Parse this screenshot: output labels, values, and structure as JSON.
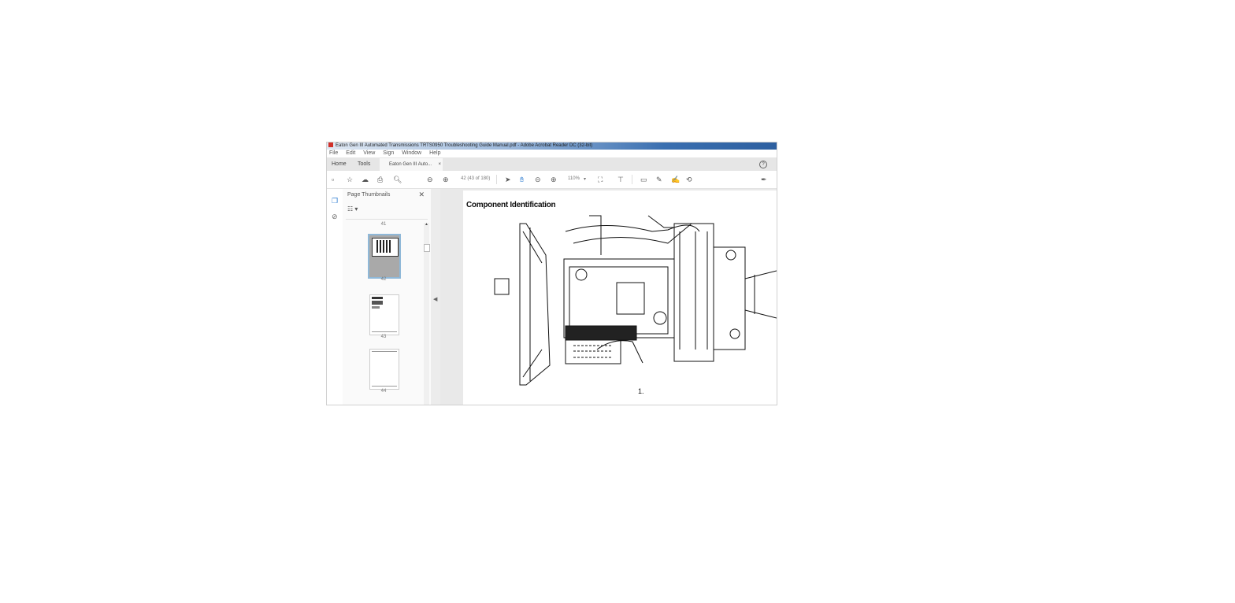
{
  "window": {
    "title": "Eaton Gen III Automated Transmissions TRTS0950 Troubleshooting Guide Manual.pdf - Adobe Acrobat Reader DC (32-bit)"
  },
  "menu": [
    "File",
    "Edit",
    "View",
    "Sign",
    "Window",
    "Help"
  ],
  "tabs": {
    "home": "Home",
    "tools": "Tools",
    "document": "Eaton Gen III Auto...",
    "close": "×",
    "help": "?"
  },
  "toolbar": {
    "page_indicator": "42  (43 of 180)",
    "zoom": "110%",
    "zoom_arrow": "▾"
  },
  "thumbnails_panel": {
    "title": "Page Thumbnails",
    "close": "✕",
    "options": "☷ ▾",
    "pages": [
      {
        "label": "41"
      },
      {
        "label": "42",
        "selected": true
      },
      {
        "label": "43"
      },
      {
        "label": "44"
      }
    ]
  },
  "splitter_arrow": "◀",
  "document": {
    "heading": "Component Identification",
    "callout": "1."
  }
}
